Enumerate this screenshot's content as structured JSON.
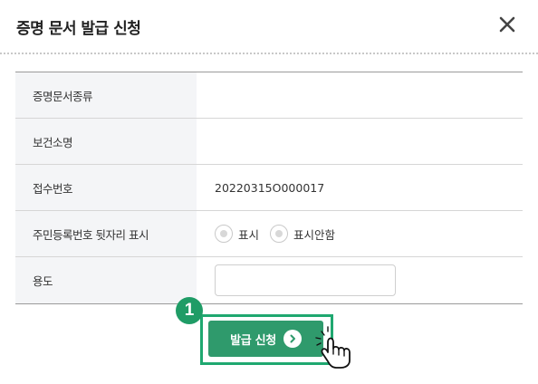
{
  "dialog": {
    "title": "증명 문서 발급 신청",
    "close_icon": "close-icon"
  },
  "form": {
    "rows": [
      {
        "label": "증명문서종류",
        "value": ""
      },
      {
        "label": "보건소명",
        "value": ""
      },
      {
        "label": "접수번호",
        "value": "20220315O000017"
      },
      {
        "label": "주민등록번호 뒷자리 표시",
        "options": [
          "표시",
          "표시안함"
        ]
      },
      {
        "label": "용도",
        "input_value": ""
      }
    ]
  },
  "action": {
    "step_number": "1",
    "submit_label": "발급 신청",
    "submit_icon": "chevron-right-circle-icon",
    "pointer_icon": "hand-pointer-icon",
    "accent_color": "#2f9a6c",
    "highlight_color": "#1fa870"
  }
}
